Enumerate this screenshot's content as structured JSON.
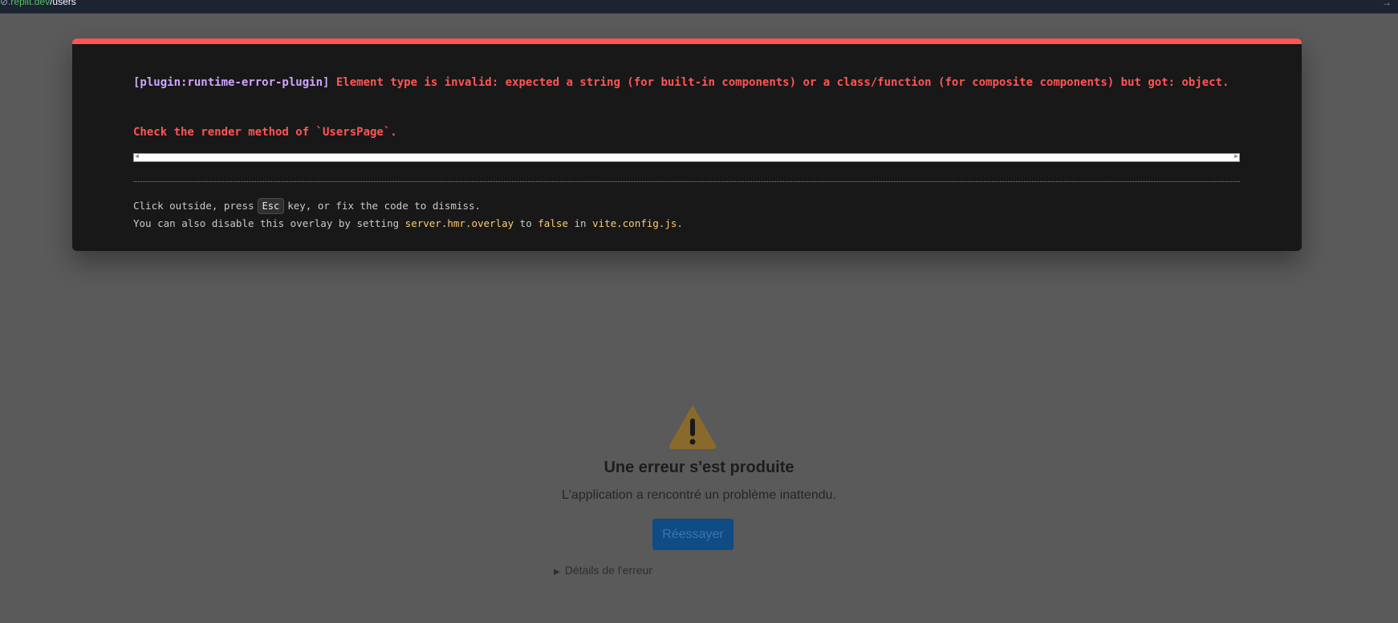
{
  "address_bar": {
    "icon": "link-icon",
    "domain": ".replit.dev",
    "path": "/users",
    "action_icon": "arrow-right-icon"
  },
  "overlay": {
    "plugin": "[plugin:runtime-error-plugin]",
    "message": "Element type is invalid: expected a string (for built-in components) or a class/function (for composite components) but got: object.",
    "message2": "Check the render method of `UsersPage`.",
    "tip_line1_before": "Click outside, press",
    "tip_key": "Esc",
    "tip_line1_after": "key, or fix the code to dismiss.",
    "tip_line2_a": "You can also disable this overlay by setting",
    "tip_line2_code1": "server.hmr.overlay",
    "tip_line2_b": "to",
    "tip_line2_code2": "false",
    "tip_line2_c": "in",
    "tip_line2_code3": "vite.config.js",
    "tip_line2_end": "."
  },
  "fallback": {
    "icon": "warning-icon",
    "title": "Une erreur s'est produite",
    "subtitle": "L'application a rencontré un problème inattendu.",
    "retry_label": "Réessayer",
    "details_label": "Détails de l'erreur"
  },
  "colors": {
    "error": "#ff5555",
    "plugin": "#cfa4ff",
    "code": "#ffcb6b",
    "button": "#0f4b84"
  }
}
